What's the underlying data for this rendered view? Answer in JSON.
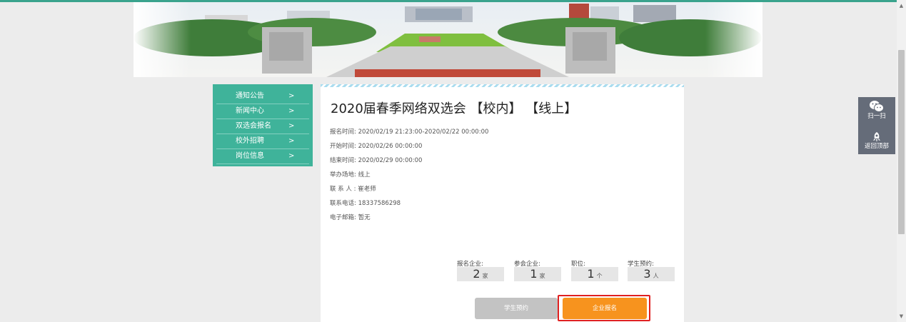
{
  "nav": {
    "items": [
      {
        "label": "通知公告",
        "arrow": ">"
      },
      {
        "label": "新闻中心",
        "arrow": ">"
      },
      {
        "label": "双选会报名",
        "arrow": ">"
      },
      {
        "label": "校外招聘",
        "arrow": ">"
      },
      {
        "label": "岗位信息",
        "arrow": ">"
      }
    ]
  },
  "fair": {
    "title": "2020届春季网络双选会 【校内】 【线上】",
    "fields": [
      {
        "label": "报名时间:",
        "value": "2020/02/19 21:23:00-2020/02/22 00:00:00"
      },
      {
        "label": "开始时间:",
        "value": "2020/02/26 00:00:00"
      },
      {
        "label": "结束时间:",
        "value": "2020/02/29 00:00:00"
      },
      {
        "label": "举办场地:",
        "value": "线上"
      },
      {
        "label": "联 系 人 :",
        "value": "崔老师"
      },
      {
        "label": "联系电话:",
        "value": "18337586298"
      },
      {
        "label": "电子邮箱:",
        "value": "暂无"
      }
    ]
  },
  "stats": [
    {
      "label": "报名企业:",
      "value": "2",
      "unit": "家"
    },
    {
      "label": "参会企业:",
      "value": "1",
      "unit": "家"
    },
    {
      "label": "职位:",
      "value": "1",
      "unit": "个"
    },
    {
      "label": "学生预约:",
      "value": "3",
      "unit": "人"
    }
  ],
  "buttons": {
    "student": "学生预约",
    "company": "企业报名"
  },
  "float_bar": {
    "scan_label": "扫一扫",
    "top_label": "返回顶部",
    "scan_icon": "wechat-icon",
    "top_icon": "rocket-icon"
  },
  "colors": {
    "accent": "#3fb39a",
    "orange": "#f7931e",
    "highlight": "#e02020"
  }
}
